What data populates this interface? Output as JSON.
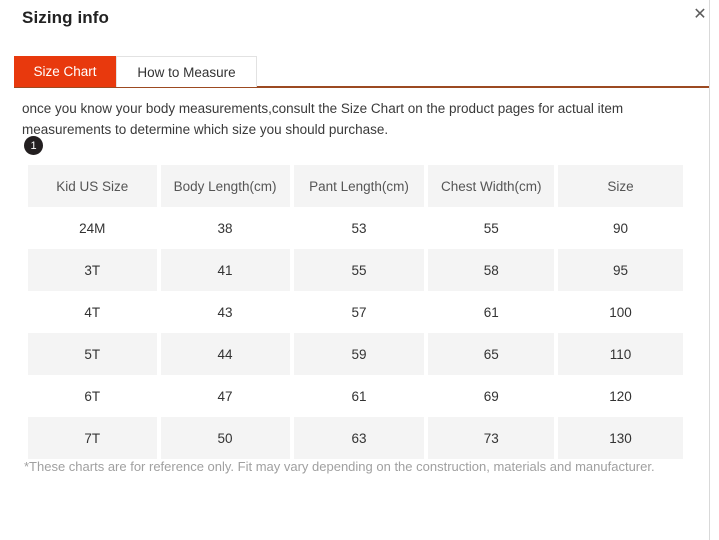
{
  "modal": {
    "title": "Sizing info",
    "close_label": "✕"
  },
  "tabs": [
    {
      "label": "Size Chart",
      "active": true
    },
    {
      "label": "How to Measure",
      "active": false
    }
  ],
  "intro": {
    "text": "once you know your body measurements,consult the Size Chart on the product pages for actual item measurements to determine which size you should purchase."
  },
  "badge": {
    "number": "1"
  },
  "table": {
    "headers": [
      "Kid US Size",
      "Body Length(cm)",
      "Pant Length(cm)",
      "Chest Width(cm)",
      "Size"
    ],
    "rows": [
      [
        "24M",
        "38",
        "53",
        "55",
        "90"
      ],
      [
        "3T",
        "41",
        "55",
        "58",
        "95"
      ],
      [
        "4T",
        "43",
        "57",
        "61",
        "100"
      ],
      [
        "5T",
        "44",
        "59",
        "65",
        "110"
      ],
      [
        "6T",
        "47",
        "61",
        "69",
        "120"
      ],
      [
        "7T",
        "50",
        "63",
        "73",
        "130"
      ]
    ]
  },
  "footnote": {
    "text": "*These charts are for reference only. Fit may vary depending on the construction, materials and manufacturer."
  },
  "colors": {
    "accent": "#e8390d",
    "tab_underline": "#9c4a21",
    "row_alt": "#f4f4f4",
    "badge_bg": "#231f20",
    "footnote": "#a0a0a0"
  }
}
